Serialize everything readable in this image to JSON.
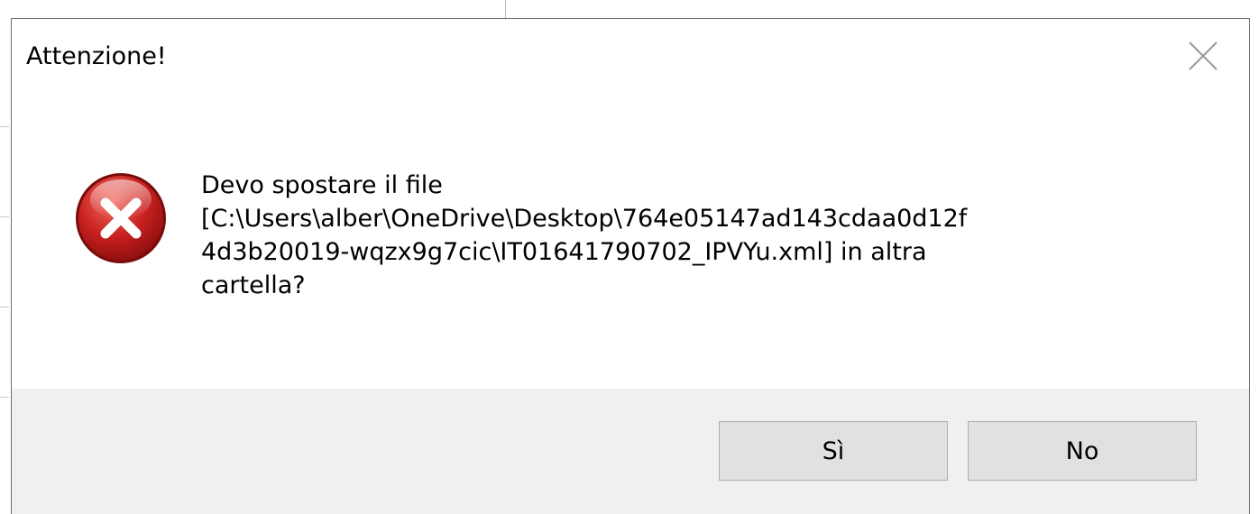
{
  "dialog": {
    "title": "Attenzione!",
    "message_lines": [
      "Devo spostare il file",
      "[C:\\Users\\alber\\OneDrive\\Desktop\\764e05147ad143cdaa0d12f",
      "4d3b20019-wqzx9g7cic\\IT01641790702_IPVYu.xml] in altra",
      "cartella?"
    ],
    "buttons": {
      "yes_label": "Sì",
      "no_label": "No"
    },
    "icons": {
      "error": "error-icon",
      "close": "close-icon"
    }
  },
  "colors": {
    "error_red": "#c8201f",
    "footer_bg": "#f0f0f0",
    "button_bg": "#e1e1e1",
    "button_border": "#adadad"
  }
}
